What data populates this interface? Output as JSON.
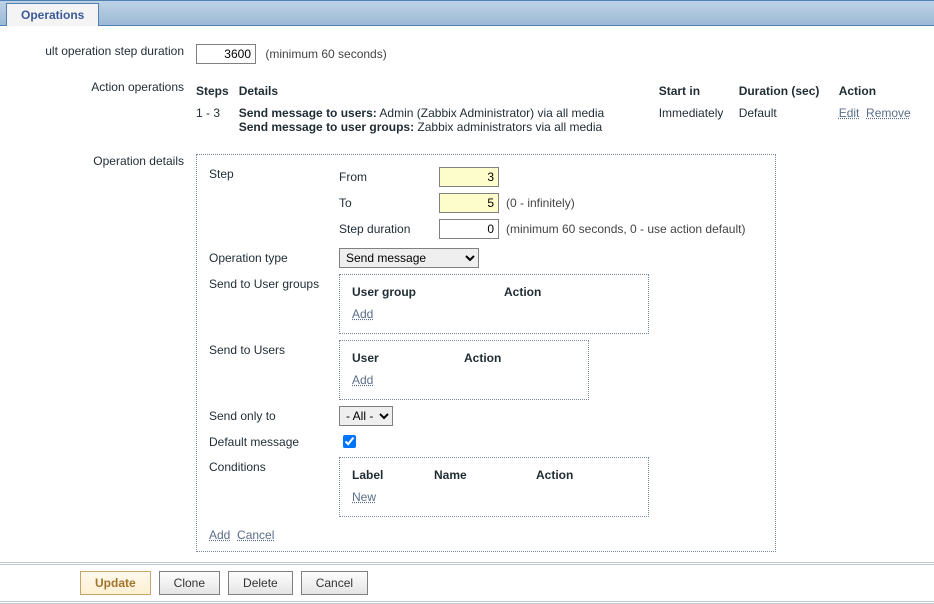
{
  "tab_label": "Operations",
  "rows": {
    "default_step_duration": {
      "label": "ult operation step duration",
      "value": "3600",
      "hint": "(minimum 60 seconds)"
    },
    "action_operations": {
      "label": "Action operations",
      "headers": {
        "steps": "Steps",
        "details": "Details",
        "start_in": "Start in",
        "duration": "Duration (sec)",
        "action": "Action"
      },
      "rows": [
        {
          "steps": "1 - 3",
          "detail_line1_label": "Send message to users:",
          "detail_line1_text": " Admin (Zabbix Administrator) via all media",
          "detail_line2_label": "Send message to user groups:",
          "detail_line2_text": " Zabbix administrators via all media",
          "start_in": "Immediately",
          "duration": "Default",
          "edit": "Edit",
          "remove": "Remove"
        }
      ]
    },
    "operation_details": {
      "label": "Operation details",
      "step_label": "Step",
      "from_label": "From",
      "from_value": "3",
      "to_label": "To",
      "to_value": "5",
      "to_hint": "(0 - infinitely)",
      "step_duration_label": "Step duration",
      "step_duration_value": "0",
      "step_duration_hint": "(minimum 60 seconds, 0 - use action default)",
      "op_type_label": "Operation type",
      "op_type_value": "Send message",
      "send_groups_label": "Send to User groups",
      "send_groups_h1": "User group",
      "send_groups_h2": "Action",
      "send_groups_add": "Add",
      "send_users_label": "Send to Users",
      "send_users_h1": "User",
      "send_users_h2": "Action",
      "send_users_add": "Add",
      "send_only_label": "Send only to",
      "send_only_value": "- All -",
      "default_msg_label": "Default message",
      "default_msg_checked": true,
      "conditions_label": "Conditions",
      "cond_h1": "Label",
      "cond_h2": "Name",
      "cond_h3": "Action",
      "cond_new": "New",
      "footer_add": "Add",
      "footer_cancel": "Cancel"
    }
  },
  "buttons": {
    "update": "Update",
    "clone": "Clone",
    "delete": "Delete",
    "cancel": "Cancel"
  }
}
